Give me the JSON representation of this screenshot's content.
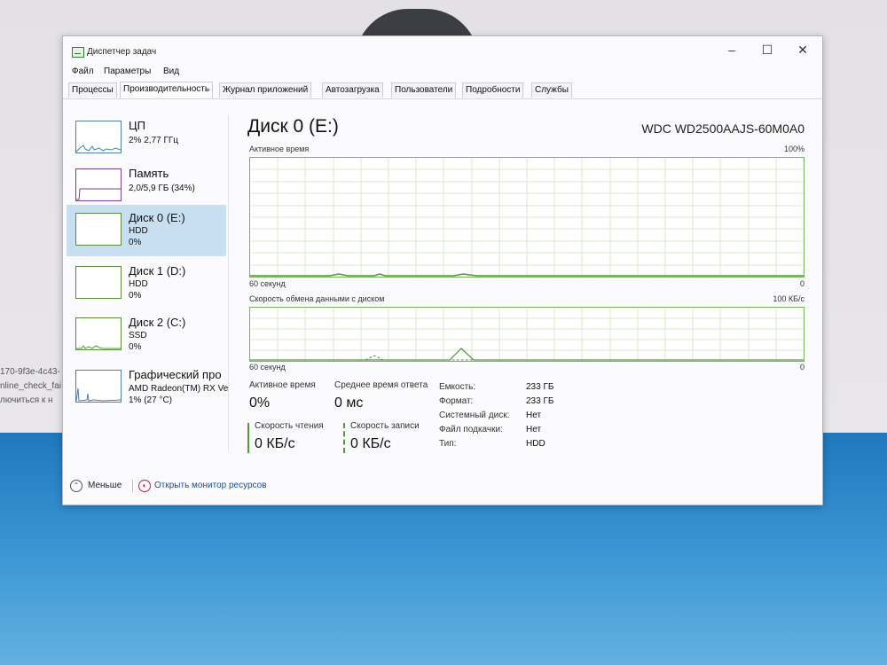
{
  "window": {
    "title": "Диспетчер задач"
  },
  "background": {
    "left_text": [
      "170-9f3e-4c43-",
      "nline_check_fai",
      "лючиться к н"
    ]
  },
  "menu": [
    "Файл",
    "Параметры",
    "Вид"
  ],
  "tabs": [
    {
      "label": "Процессы",
      "active": false
    },
    {
      "label": "Производительность",
      "active": true
    },
    {
      "label": "Журнал приложений",
      "active": false
    },
    {
      "label": "Автозагрузка",
      "active": false
    },
    {
      "label": "Пользователи",
      "active": false
    },
    {
      "label": "Подробности",
      "active": false
    },
    {
      "label": "Службы",
      "active": false
    }
  ],
  "sidebar": {
    "items": [
      {
        "title": "ЦП",
        "line1": "2% 2,77 ГГц",
        "line2": "",
        "selected": false
      },
      {
        "title": "Память",
        "line1": "2,0/5,9 ГБ (34%)",
        "line2": "",
        "selected": false
      },
      {
        "title": "Диск 0 (E:)",
        "line1": "HDD",
        "line2": "0%",
        "selected": true
      },
      {
        "title": "Диск 1 (D:)",
        "line1": "HDD",
        "line2": "0%",
        "selected": false
      },
      {
        "title": "Диск 2 (C:)",
        "line1": "SSD",
        "line2": "0%",
        "selected": false
      },
      {
        "title": "Графический про",
        "line1": "AMD Radeon(TM) RX Ve",
        "line2": "1% (27 °C)",
        "selected": false
      }
    ]
  },
  "detail": {
    "title": "Диск 0 (E:)",
    "model": "WDC WD2500AAJS-60M0A0",
    "graph1": {
      "label": "Активное время",
      "max_label": "100%",
      "x_label": "60 секунд",
      "min_label": "0"
    },
    "graph2": {
      "label": "Скорость обмена данными с диском",
      "max_label": "100 КБ/с",
      "x_label": "60 секунд",
      "min_label": "0"
    },
    "stats": {
      "active_time_label": "Активное время",
      "active_time_value": "0%",
      "response_label": "Среднее время ответа",
      "response_value": "0 мс",
      "read_label": "Скорость чтения",
      "read_value": "0 КБ/с",
      "write_label": "Скорость записи",
      "write_value": "0 КБ/с"
    },
    "info": [
      {
        "key": "Емкость:",
        "value": "233 ГБ"
      },
      {
        "key": "Формат:",
        "value": "233 ГБ"
      },
      {
        "key": "Системный диск:",
        "value": "Нет"
      },
      {
        "key": "Файл подкачки:",
        "value": "Нет"
      },
      {
        "key": "Тип:",
        "value": "HDD"
      }
    ]
  },
  "footer": {
    "less_label": "Меньше",
    "monitor_label": "Открыть монитор ресурсов"
  }
}
